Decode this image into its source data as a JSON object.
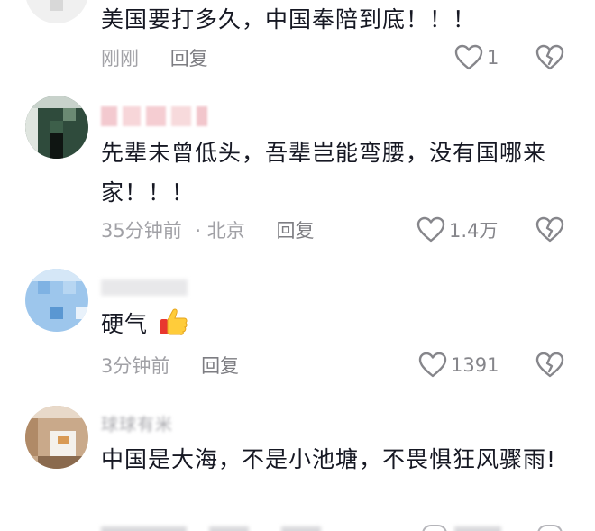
{
  "comments": [
    {
      "username": "",
      "text": "美国要打多久，中国奉陪到底！！！",
      "time": "刚刚",
      "location": "",
      "reply_label": "回复",
      "likes": "1"
    },
    {
      "username": "",
      "text": "先辈未曾低头，吾辈岂能弯腰，没有国哪来家！！！",
      "time": "35分钟前",
      "location": "· 北京",
      "reply_label": "回复",
      "likes": "1.4万"
    },
    {
      "username": "",
      "text": "硬气",
      "time": "3分钟前",
      "location": "",
      "reply_label": "回复",
      "likes": "1391"
    },
    {
      "username": "球球有米",
      "text": "中国是大海，不是小池塘，不畏惧狂风骤雨!",
      "time": "",
      "location": "",
      "reply_label": "",
      "likes": ""
    }
  ],
  "icons": {
    "like": "heart-outline-icon",
    "dislike": "broken-heart-icon",
    "emoji": "thumbs-up-emoji"
  },
  "colors": {
    "text": "#161823",
    "meta": "#a1a1a6",
    "icon": "#86868b"
  }
}
